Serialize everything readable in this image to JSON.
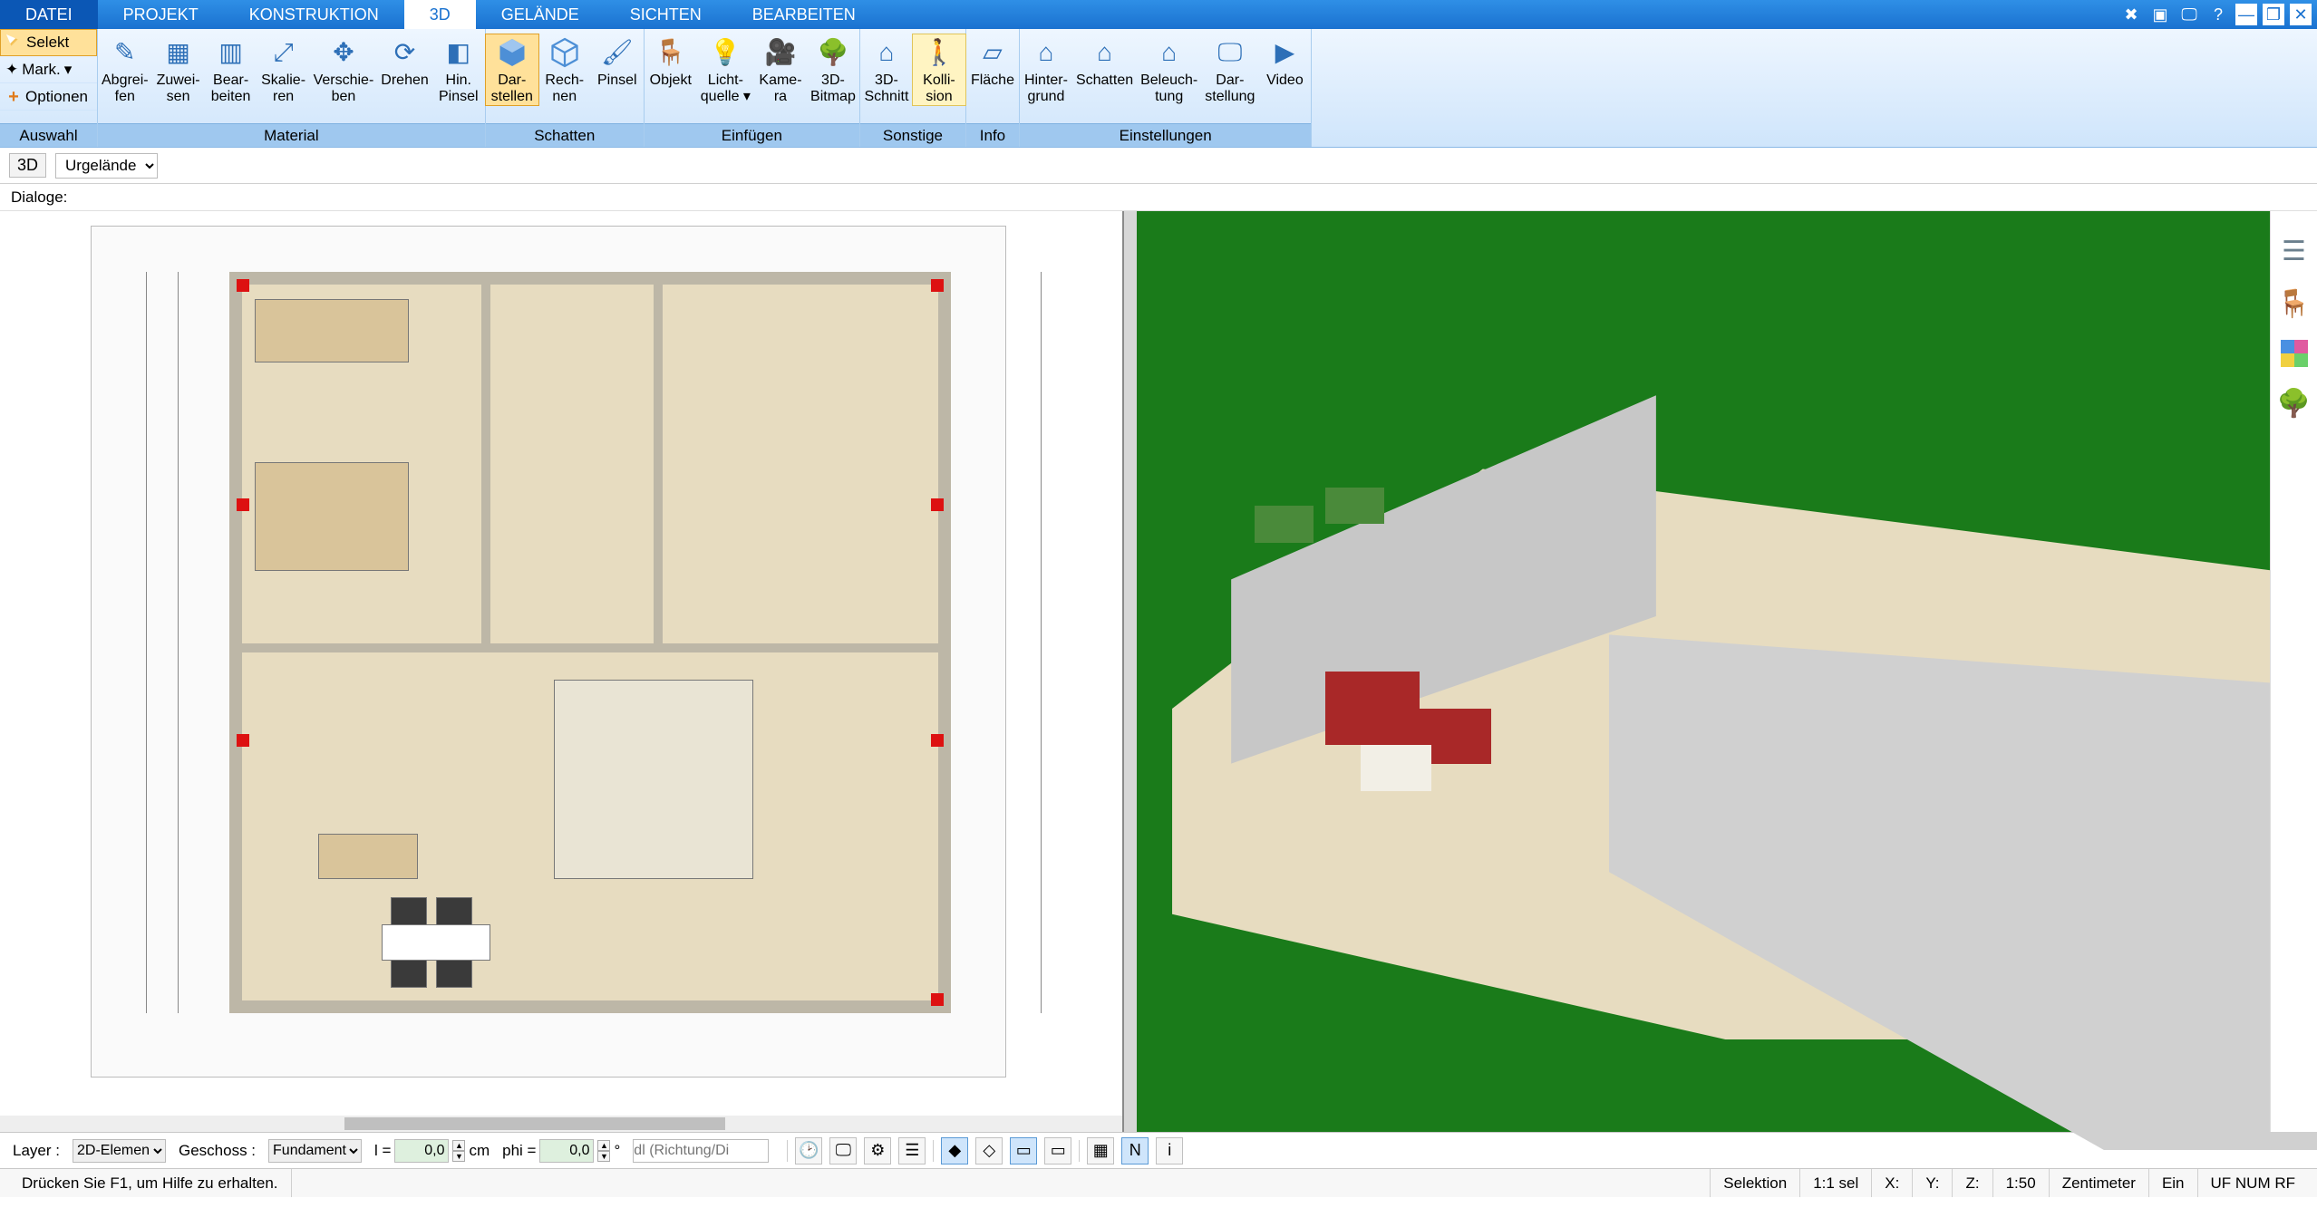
{
  "tabs": {
    "datei": "DATEI",
    "projekt": "PROJEKT",
    "konstruktion": "KONSTRUKTION",
    "d3": "3D",
    "gelaende": "GELÄNDE",
    "sichten": "SICHTEN",
    "bearbeiten": "BEARBEITEN"
  },
  "selcol": {
    "selekt": "Selekt",
    "mark": "Mark.",
    "optionen": "Optionen",
    "footer": "Auswahl"
  },
  "groups": {
    "material": "Material",
    "schatten": "Schatten",
    "einfuegen": "Einfügen",
    "sonstige": "Sonstige",
    "info": "Info",
    "einstellungen": "Einstellungen"
  },
  "btn": {
    "abgreifen1": "Abgrei-",
    "abgreifen2": "fen",
    "zuweisen1": "Zuwei-",
    "zuweisen2": "sen",
    "bearbeiten1": "Bear-",
    "bearbeiten2": "beiten",
    "skalieren1": "Skalie-",
    "skalieren2": "ren",
    "verschieben1": "Verschie-",
    "verschieben2": "ben",
    "drehen": "Drehen",
    "hinpinsel1": "Hin.",
    "hinpinsel2": "Pinsel",
    "darstellen1": "Dar-",
    "darstellen2": "stellen",
    "rechnen1": "Rech-",
    "rechnen2": "nen",
    "pinsel": "Pinsel",
    "objekt": "Objekt",
    "lichtquelle1": "Licht-",
    "lichtquelle2": "quelle ▾",
    "kamera1": "Kame-",
    "kamera2": "ra",
    "d3bitmap1": "3D-",
    "d3bitmap2": "Bitmap",
    "d3schnitt1": "3D-",
    "d3schnitt2": "Schnitt",
    "kollision1": "Kolli-",
    "kollision2": "sion",
    "flaeche": "Fläche",
    "hintergrund1": "Hinter-",
    "hintergrund2": "grund",
    "schatten_set": "Schatten",
    "beleuchtung1": "Beleuch-",
    "beleuchtung2": "tung",
    "darstellung1": "Dar-",
    "darstellung2": "stellung",
    "video": "Video"
  },
  "subbar": {
    "badge": "3D",
    "layer_select": "Urgelände"
  },
  "dialoge_label": "Dialoge:",
  "bottom": {
    "layer_label": "Layer :",
    "layer_value": "2D-Elemen",
    "geschoss_label": "Geschoss :",
    "geschoss_value": "Fundament",
    "l_label": "l =",
    "l_value": "0,0",
    "l_unit": "cm",
    "phi_label": "phi =",
    "phi_value": "0,0",
    "phi_unit": "°",
    "dl_placeholder": "dl (Richtung/Di"
  },
  "status": {
    "help": "Drücken Sie F1, um Hilfe zu erhalten.",
    "mode": "Selektion",
    "sel": "1:1 sel",
    "x": "X:",
    "y": "Y:",
    "z": "Z:",
    "scale": "1:50",
    "unit": "Zentimeter",
    "ein": "Ein",
    "caps": "UF NUM RF"
  }
}
